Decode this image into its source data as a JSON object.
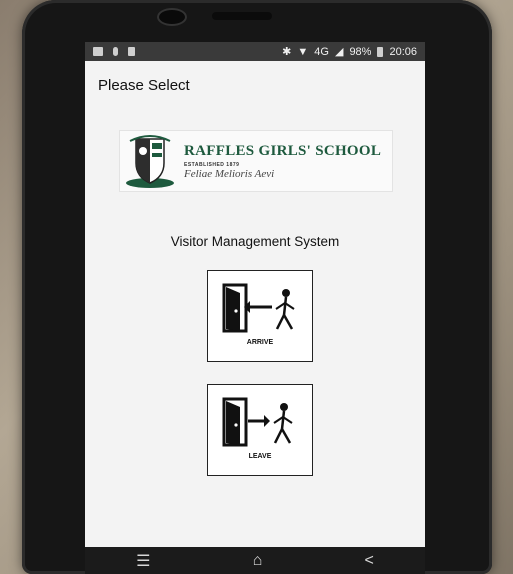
{
  "status_bar": {
    "bluetooth": "✱",
    "network": "4G",
    "battery": "98%",
    "time": "20:06"
  },
  "header": {
    "title": "Please Select"
  },
  "logo": {
    "school_name": "RAFFLES GIRLS' SCHOOL",
    "established": "ESTABLISHED 1879",
    "motto": "Feliae Melioris Aevi"
  },
  "main": {
    "system_title": "Visitor Management System",
    "arrive_label": "ARRIVE",
    "leave_label": "LEAVE"
  },
  "nav": {
    "menu": "☰",
    "home": "⌂",
    "back": "<"
  },
  "colors": {
    "brand_green": "#1e5a3e",
    "screen_bg": "#f3f3f3"
  }
}
